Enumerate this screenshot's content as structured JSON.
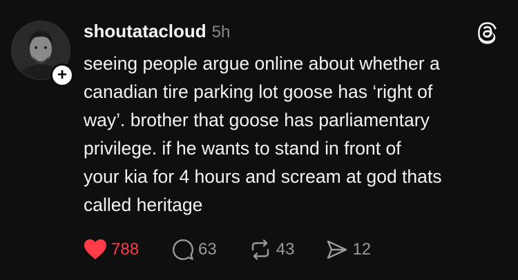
{
  "post": {
    "author": {
      "username": "shoutatacloud",
      "timestamp": "5h",
      "avatar_icon": "profile-photo",
      "follow_icon": "plus-icon"
    },
    "app_icon": "threads-logo-icon",
    "text": "seeing people argue online about whether a\ncanadian tire parking lot goose has ‘right of\nway’. brother that goose has parliamentary\nprivilege. if he wants to stand in front of\nyour kia for 4 hours and scream at god thats\ncalled heritage",
    "actions": {
      "like": {
        "icon": "heart-icon",
        "count": "788",
        "liked": true,
        "color": "#ff3b4a"
      },
      "reply": {
        "icon": "reply-bubble-icon",
        "count": "63"
      },
      "repost": {
        "icon": "repost-icon",
        "count": "43"
      },
      "share": {
        "icon": "send-icon",
        "count": "12"
      }
    }
  },
  "colors": {
    "background": "#0f0f0f",
    "text": "#f3f3f3",
    "muted": "#9a9a9a",
    "like": "#ff3b4a"
  }
}
